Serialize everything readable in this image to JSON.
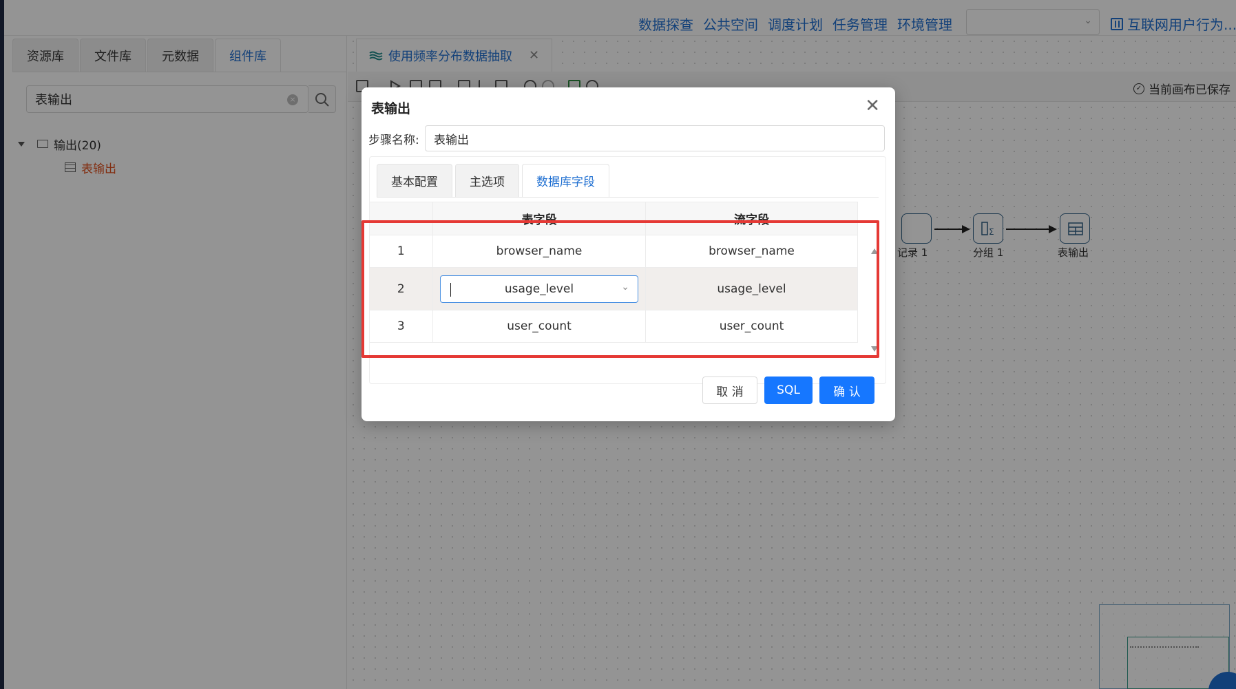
{
  "top_nav": {
    "items": [
      "数据探查",
      "公共空间",
      "调度计划",
      "任务管理",
      "环境管理"
    ],
    "project_name": "互联网用户行为..."
  },
  "left_panel": {
    "tabs": [
      "资源库",
      "文件库",
      "元数据",
      "组件库"
    ],
    "active_tab": "组件库",
    "search_value": "表输出",
    "tree": {
      "folder_label": "输出(20)",
      "leaf_label": "表输出"
    }
  },
  "editor": {
    "doc_tab_title": "使用频率分布数据抽取",
    "saved_status": "当前画布已保存",
    "nodes": [
      {
        "label": "记录 1"
      },
      {
        "label": "分组 1"
      },
      {
        "label": "表输出"
      }
    ]
  },
  "dialog": {
    "title": "表输出",
    "step_name_label": "步骤名称:",
    "step_name_value": "表输出",
    "tabs": [
      "基本配置",
      "主选项",
      "数据库字段"
    ],
    "active_tab": "数据库字段",
    "table": {
      "headers": [
        "",
        "表字段",
        "流字段"
      ],
      "rows": [
        {
          "index": "1",
          "table_field": "browser_name",
          "stream_field": "browser_name"
        },
        {
          "index": "2",
          "table_field": "usage_level",
          "stream_field": "usage_level"
        },
        {
          "index": "3",
          "table_field": "user_count",
          "stream_field": "user_count"
        }
      ]
    },
    "buttons": {
      "cancel": "取 消",
      "sql": "SQL",
      "confirm": "确 认"
    }
  },
  "colors": {
    "accent": "#1677ff",
    "nav_link": "#1f6fd1",
    "highlight_box": "#e53935",
    "tree_leaf": "#e0501e"
  }
}
